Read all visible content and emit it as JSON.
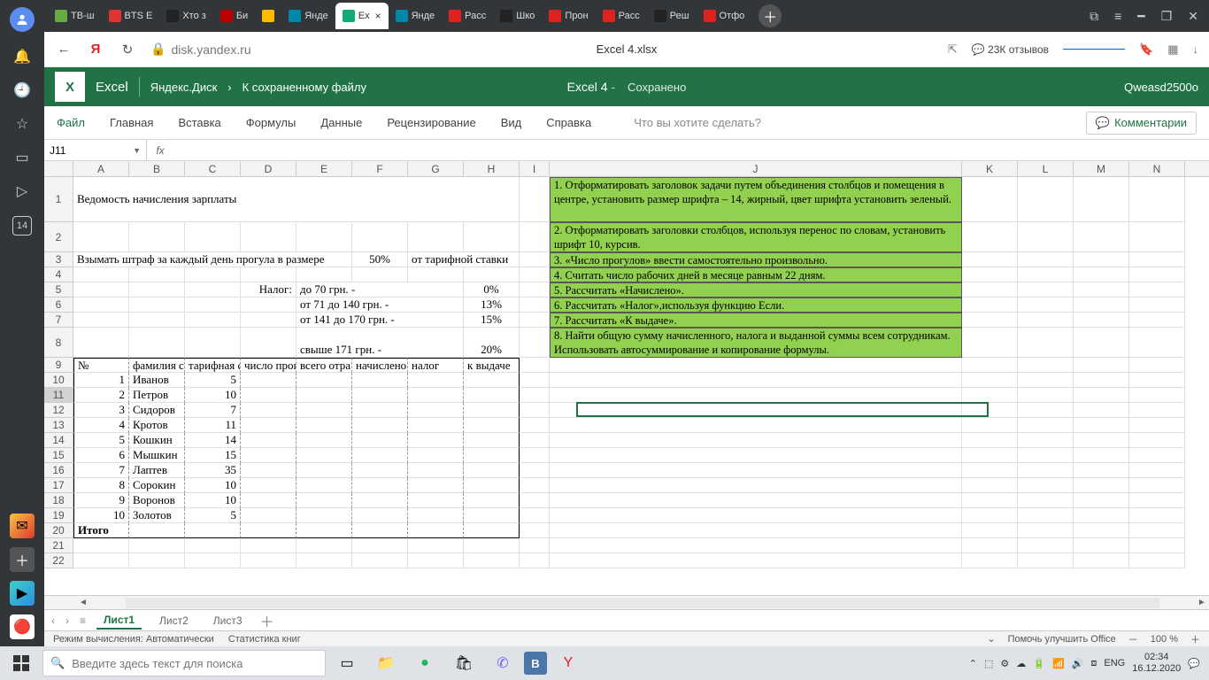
{
  "browser": {
    "tabs": [
      "ТВ-ш",
      "BTS E",
      "Хто з",
      "Би",
      "Янде",
      "Ex",
      "Янде",
      "Расс",
      "Шко",
      "Прон",
      "Расс",
      "Реш",
      "Отфо"
    ],
    "active_tab_index": 5,
    "url": "disk.yandex.ru",
    "page_title": "Excel 4.xlsx",
    "reviews": "23К отзывов"
  },
  "sidebar": {
    "badge": "14"
  },
  "excel": {
    "brand": "Excel",
    "crumb1": "Яндекс.Диск",
    "crumb2": "К сохраненному файлу",
    "doc_name": "Excel 4",
    "saved": "Сохранено",
    "user": "Qweasd2500o",
    "ribbon": [
      "Файл",
      "Главная",
      "Вставка",
      "Формулы",
      "Данные",
      "Рецензирование",
      "Вид",
      "Справка"
    ],
    "tellme": "Что вы хотите сделать?",
    "comments": "Комментарии",
    "name_box": "J11",
    "formula": ""
  },
  "cols": [
    "A",
    "B",
    "C",
    "D",
    "E",
    "F",
    "G",
    "H",
    "I",
    "J",
    "K",
    "L",
    "M",
    "N"
  ],
  "content": {
    "title": "Ведомость начисления зарплаты",
    "fine_text": "Взымать штраф за каждый день прогула в размере",
    "fine_pct": "50%",
    "fine_suffix": "от тарифной ставки",
    "tax_label": "Налог:",
    "tax_rows": [
      {
        "label": "до   70 грн.   -",
        "pct": "0%"
      },
      {
        "label": "от 71 до 140 грн.  -",
        "pct": "13%"
      },
      {
        "label": "от 141 до 170 грн.  -",
        "pct": "15%"
      },
      {
        "label": "свыше 171 грн.    -",
        "pct": "20%"
      }
    ],
    "headers": [
      "№",
      "фамилия с",
      "тарифная с",
      "число прог",
      "всего отра",
      "начислено",
      "налог",
      "к выдаче"
    ],
    "rows": [
      {
        "n": "1",
        "name": "Иванов",
        "rate": "5"
      },
      {
        "n": "2",
        "name": "Петров",
        "rate": "10"
      },
      {
        "n": "3",
        "name": "Сидоров",
        "rate": "7"
      },
      {
        "n": "4",
        "name": "Кротов",
        "rate": "11"
      },
      {
        "n": "5",
        "name": "Кошкин",
        "rate": "14"
      },
      {
        "n": "6",
        "name": "Мышкин",
        "rate": "15"
      },
      {
        "n": "7",
        "name": "Лаптев",
        "rate": "35"
      },
      {
        "n": "8",
        "name": "Сорокин",
        "rate": "10"
      },
      {
        "n": "9",
        "name": "Воронов",
        "rate": "10"
      },
      {
        "n": "10",
        "name": "Золотов",
        "rate": "5"
      }
    ],
    "total": "Итого",
    "instructions": [
      "1. Отформатировать заголовок задачи путем объединения столбцов и помещения в центре, установить размер шрифта – 14, жирный, цвет шрифта установить зеленый.",
      "2. Отформатировать заголовки столбцов, используя перенос по словам, установить шрифт 10, курсив.",
      "3. «Число прогулов» ввести самостоятельно произвольно.",
      "4. Считать число рабочих дней в месяце равным 22 дням.",
      "5. Рассчитать «Начислено».",
      "6. Рассчитать «Налог»,используя функцию Если.",
      "7. Рассчитать «К выдаче».",
      "8. Найти общую сумму начисленного, налога и выданной суммы всем сотрудникам. Использовать автосуммирование и копирование формулы."
    ]
  },
  "sheet_tabs": [
    "Лист1",
    "Лист2",
    "Лист3"
  ],
  "status": {
    "calc": "Режим вычисления: Автоматически",
    "stats": "Статистика книг",
    "help": "Помочь улучшить Office",
    "zoom": "100 %"
  },
  "taskbar": {
    "search_placeholder": "Введите здесь текст для поиска",
    "lang": "ENG",
    "time": "02:34",
    "date": "16.12.2020"
  }
}
